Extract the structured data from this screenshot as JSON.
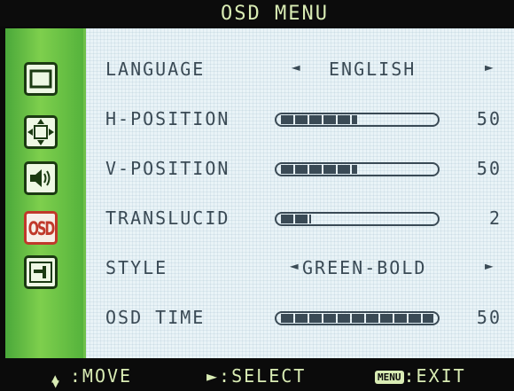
{
  "title": "OSD MENU",
  "sidebar": {
    "items": [
      {
        "icon": "picture-icon"
      },
      {
        "icon": "position-icon"
      },
      {
        "icon": "speaker-icon"
      },
      {
        "icon": "osd-icon",
        "label": "OSD",
        "active": true
      },
      {
        "icon": "tools-icon"
      }
    ]
  },
  "menu": {
    "language": {
      "label": "LANGUAGE",
      "value": "ENGLISH"
    },
    "h_position": {
      "label": "H-POSITION",
      "value": "50",
      "level": 50
    },
    "v_position": {
      "label": "V-POSITION",
      "value": "50",
      "level": 50
    },
    "translucid": {
      "label": "TRANSLUCID",
      "value": "2",
      "level": 20
    },
    "style": {
      "label": "STYLE",
      "value": "GREEN-BOLD"
    },
    "osd_time": {
      "label": "OSD TIME",
      "value": "50",
      "level": 100
    }
  },
  "status": {
    "move": ":MOVE",
    "select": "►:SELECT",
    "menu_badge": "MENU",
    "exit": ":EXIT"
  },
  "colors": {
    "sidebar_green": "#7ecf4d",
    "panel_bg": "#e9f3f7",
    "text": "#3a4a55",
    "active_red": "#c0392b"
  }
}
